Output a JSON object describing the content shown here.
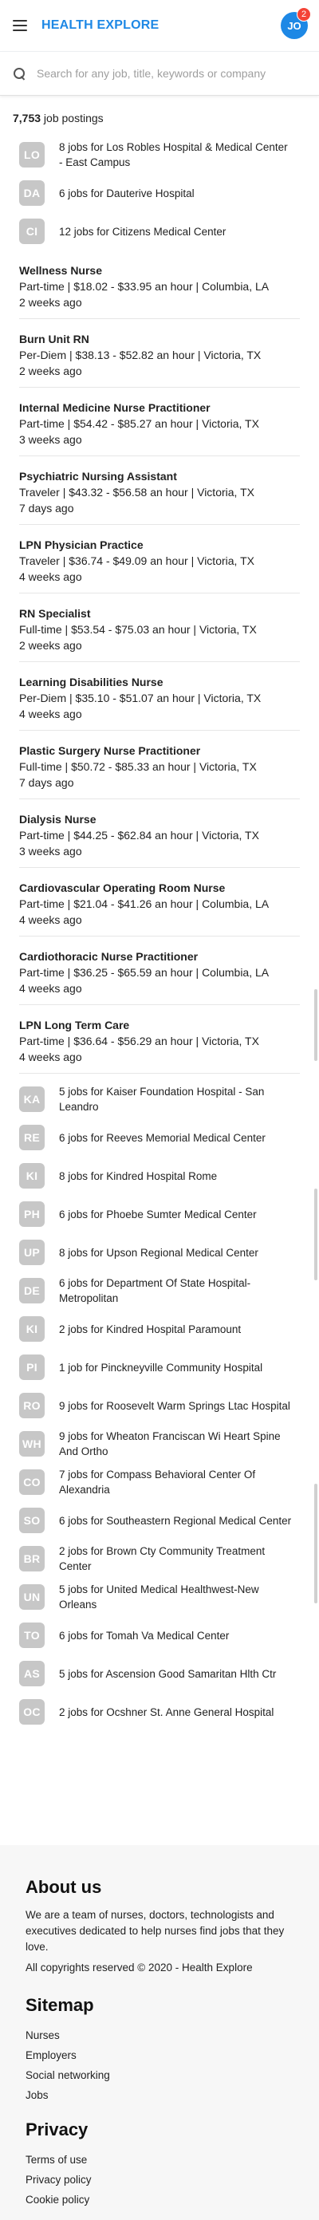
{
  "header": {
    "brand": "HEALTH EXPLORE",
    "avatar_initials": "JO",
    "notification_count": "2"
  },
  "search": {
    "placeholder": "Search for any job, title, keywords or company"
  },
  "postings": {
    "count": "7,753",
    "suffix": " job postings"
  },
  "top_companies": [
    {
      "initials": "LO",
      "text": "8 jobs for Los Robles Hospital & Medical Center - East Campus"
    },
    {
      "initials": "DA",
      "text": "6 jobs for Dauterive Hospital"
    },
    {
      "initials": "CI",
      "text": "12 jobs for Citizens Medical Center"
    }
  ],
  "jobs": [
    {
      "title": "Wellness Nurse",
      "meta": "Part-time | $18.02 - $33.95 an hour | Columbia, LA",
      "ago": "2 weeks ago"
    },
    {
      "title": "Burn Unit RN",
      "meta": "Per-Diem | $38.13 - $52.82 an hour | Victoria, TX",
      "ago": "2 weeks ago"
    },
    {
      "title": "Internal Medicine Nurse Practitioner",
      "meta": "Part-time | $54.42 - $85.27 an hour | Victoria, TX",
      "ago": "3 weeks ago"
    },
    {
      "title": "Psychiatric Nursing Assistant",
      "meta": "Traveler | $43.32 - $56.58 an hour | Victoria, TX",
      "ago": "7 days ago"
    },
    {
      "title": "LPN Physician Practice",
      "meta": "Traveler | $36.74 - $49.09 an hour | Victoria, TX",
      "ago": "4 weeks ago"
    },
    {
      "title": "RN Specialist",
      "meta": "Full-time | $53.54 - $75.03 an hour | Victoria, TX",
      "ago": "2 weeks ago"
    },
    {
      "title": "Learning Disabilities Nurse",
      "meta": "Per-Diem | $35.10 - $51.07 an hour | Victoria, TX",
      "ago": "4 weeks ago"
    },
    {
      "title": "Plastic Surgery Nurse Practitioner",
      "meta": "Full-time | $50.72 - $85.33 an hour | Victoria, TX",
      "ago": "7 days ago"
    },
    {
      "title": "Dialysis Nurse",
      "meta": "Part-time | $44.25 - $62.84 an hour | Victoria, TX",
      "ago": "3 weeks ago"
    },
    {
      "title": "Cardiovascular Operating Room Nurse",
      "meta": "Part-time | $21.04 - $41.26 an hour | Columbia, LA",
      "ago": "4 weeks ago"
    },
    {
      "title": "Cardiothoracic Nurse Practitioner",
      "meta": "Part-time | $36.25 - $65.59 an hour | Columbia, LA",
      "ago": "4 weeks ago"
    },
    {
      "title": "LPN Long Term Care",
      "meta": "Part-time | $36.64 - $56.29 an hour | Victoria, TX",
      "ago": "4 weeks ago"
    }
  ],
  "bottom_companies": [
    {
      "initials": "KA",
      "text": "5 jobs for Kaiser Foundation Hospital - San Leandro"
    },
    {
      "initials": "RE",
      "text": "6 jobs for Reeves Memorial Medical Center"
    },
    {
      "initials": "KI",
      "text": "8 jobs for Kindred Hospital Rome"
    },
    {
      "initials": "PH",
      "text": "6 jobs for Phoebe Sumter Medical Center"
    },
    {
      "initials": "UP",
      "text": "8 jobs for Upson Regional Medical Center"
    },
    {
      "initials": "DE",
      "text": "6 jobs for Department Of State Hospital-Metropolitan"
    },
    {
      "initials": "KI",
      "text": "2 jobs for Kindred Hospital Paramount"
    },
    {
      "initials": "PI",
      "text": "1 job for Pinckneyville Community Hospital"
    },
    {
      "initials": "RO",
      "text": "9 jobs for Roosevelt Warm Springs Ltac Hospital"
    },
    {
      "initials": "WH",
      "text": "9 jobs for Wheaton Franciscan Wi Heart Spine And Ortho"
    },
    {
      "initials": "CO",
      "text": "7 jobs for Compass Behavioral Center Of Alexandria"
    },
    {
      "initials": "SO",
      "text": "6 jobs for Southeastern Regional Medical Center"
    },
    {
      "initials": "BR",
      "text": "2 jobs for Brown Cty Community Treatment Center"
    },
    {
      "initials": "UN",
      "text": "5 jobs for United Medical Healthwest-New Orleans"
    },
    {
      "initials": "TO",
      "text": "6 jobs for Tomah Va Medical Center"
    },
    {
      "initials": "AS",
      "text": "5 jobs for Ascension Good Samaritan Hlth Ctr"
    },
    {
      "initials": "OC",
      "text": "2 jobs for Ocshner St. Anne General Hospital"
    }
  ],
  "footer": {
    "about_title": "About us",
    "about_text": "We are a team of nurses, doctors, technologists and executives dedicated to help nurses find jobs that they love.",
    "copyright": "All copyrights reserved © 2020 - Health Explore",
    "sitemap_title": "Sitemap",
    "sitemap_links": [
      "Nurses",
      "Employers",
      "Social networking",
      "Jobs"
    ],
    "privacy_title": "Privacy",
    "privacy_links": [
      "Terms of use",
      "Privacy policy",
      "Cookie policy"
    ]
  },
  "colors": {
    "brand": "#1e88e5",
    "badge": "#f44336",
    "logo_bg": "#c7c7c7"
  }
}
